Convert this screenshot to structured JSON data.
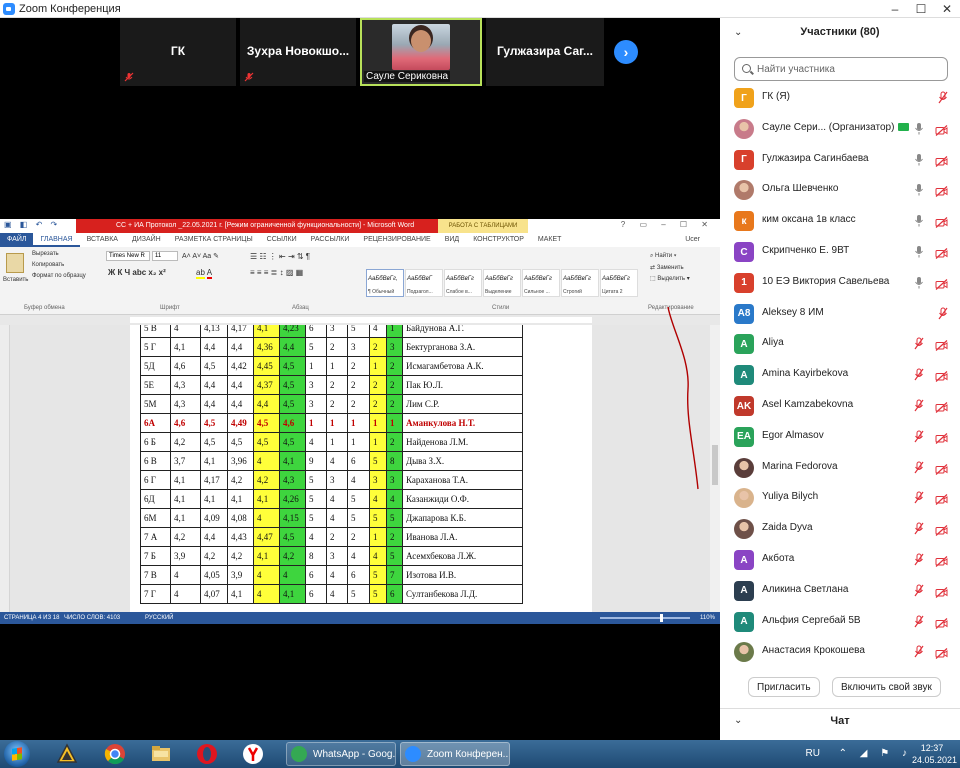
{
  "window": {
    "title": "Zoom Конференция",
    "controls": [
      "–",
      "☐",
      "✕"
    ]
  },
  "thumbnails": [
    {
      "name": "ГК",
      "mic_off": true
    },
    {
      "name": "Зухра Новокшо...",
      "mic_off": true
    },
    {
      "name": "Сауле Сериковна",
      "video": true,
      "active": true
    },
    {
      "name": "Гулжазира Саг..."
    }
  ],
  "word": {
    "title": "СС + ИА Протокол _22.05.2021 г. [Режим ограниченной функциональности] - Microsoft Word",
    "table_tools": "РАБОТА С ТАБЛИЦАМИ",
    "tabs": [
      "ФАЙЛ",
      "ГЛАВНАЯ",
      "ВСТАВКА",
      "ДИЗАЙН",
      "РАЗМЕТКА СТРАНИЦЫ",
      "ССЫЛКИ",
      "РАССЫЛКИ",
      "РЕЦЕНЗИРОВАНИЕ",
      "ВИД",
      "КОНСТРУКТОР",
      "МАКЕТ"
    ],
    "user": "Ucer",
    "ribbon": {
      "paste": "Вставить",
      "cut": "Вырезать",
      "copy": "Копировать",
      "format_painter": "Формат по образцу",
      "font_name": "Times New R",
      "font_size": "11",
      "group_clipboard": "Буфер обмена",
      "group_font": "Шрифт",
      "group_paragraph": "Абзац",
      "group_styles": "Стили",
      "group_editing": "Редактирование",
      "find": "Найти",
      "replace": "Заменить",
      "select": "Выделить",
      "styles": [
        {
          "sample": "АаБбВвГг,",
          "name": "¶ Обычный"
        },
        {
          "sample": "АаБбВвГ",
          "name": "Подзагол..."
        },
        {
          "sample": "АаБбВвГг",
          "name": "Слабое в..."
        },
        {
          "sample": "АаБбВвГг",
          "name": "Выделение"
        },
        {
          "sample": "АаБбВвГг",
          "name": "Сильное ..."
        },
        {
          "sample": "АаБбВвГг",
          "name": "Строгий"
        },
        {
          "sample": "АаБбВвГг",
          "name": "Цитата 2"
        }
      ]
    },
    "table_rows": [
      {
        "cells": [
          "5 В",
          "4",
          "4,13",
          "4,17",
          "4,1",
          "4,23",
          "6",
          "3",
          "5",
          "4",
          "1",
          "Байдунова А.Г."
        ],
        "hl": [
          "",
          "",
          "",
          "",
          "y",
          "g",
          "",
          "",
          "",
          "",
          "g",
          ""
        ]
      },
      {
        "cells": [
          "5 Г",
          "4,1",
          "4,4",
          "4,4",
          "4,36",
          "4,4",
          "5",
          "2",
          "3",
          "2",
          "3",
          "Бектурганова З.А."
        ],
        "hl": [
          "",
          "",
          "",
          "",
          "y",
          "g",
          "",
          "",
          "",
          "y",
          "g",
          ""
        ]
      },
      {
        "cells": [
          "5Д",
          "4,6",
          "4,5",
          "4,42",
          "4,45",
          "4,5",
          "1",
          "1",
          "2",
          "1",
          "2",
          "Исмагамбетова А.К."
        ],
        "hl": [
          "",
          "",
          "",
          "",
          "y",
          "g",
          "",
          "",
          "",
          "y",
          "g",
          ""
        ]
      },
      {
        "cells": [
          "5Е",
          "4,3",
          "4,4",
          "4,4",
          "4,37",
          "4,5",
          "3",
          "2",
          "2",
          "2",
          "2",
          "Пак Ю.Л."
        ],
        "hl": [
          "",
          "",
          "",
          "",
          "y",
          "g",
          "",
          "",
          "",
          "y",
          "g",
          ""
        ]
      },
      {
        "cells": [
          "5М",
          "4,3",
          "4,4",
          "4,4",
          "4,4",
          "4,5",
          "3",
          "2",
          "2",
          "2",
          "2",
          "Лим С.Р."
        ],
        "hl": [
          "",
          "",
          "",
          "",
          "y",
          "g",
          "",
          "",
          "",
          "y",
          "g",
          ""
        ]
      },
      {
        "cells": [
          "6А",
          "4,6",
          "4,5",
          "4,49",
          "4,5",
          "4,6",
          "1",
          "1",
          "1",
          "1",
          "1",
          "Аманкулова Н.Т."
        ],
        "hl": [
          "",
          "",
          "",
          "",
          "y",
          "g",
          "",
          "",
          "",
          "y",
          "g",
          ""
        ],
        "bold": true
      },
      {
        "cells": [
          "6 Б",
          "4,2",
          "4,5",
          "4,5",
          "4,5",
          "4,5",
          "4",
          "1",
          "1",
          "1",
          "2",
          "Найденова Л.М."
        ],
        "hl": [
          "",
          "",
          "",
          "",
          "y",
          "g",
          "",
          "",
          "",
          "y",
          "g",
          ""
        ]
      },
      {
        "cells": [
          "6 В",
          "3,7",
          "4,1",
          "3,96",
          "4",
          "4,1",
          "9",
          "4",
          "6",
          "5",
          "8",
          "Дыва З.Х."
        ],
        "hl": [
          "",
          "",
          "",
          "",
          "y",
          "g",
          "",
          "",
          "",
          "y",
          "g",
          ""
        ]
      },
      {
        "cells": [
          "6 Г",
          "4,1",
          "4,17",
          "4,2",
          "4,2",
          "4,3",
          "5",
          "3",
          "4",
          "3",
          "3",
          "Караханова Т.А."
        ],
        "hl": [
          "",
          "",
          "",
          "",
          "y",
          "g",
          "",
          "",
          "",
          "y",
          "g",
          ""
        ]
      },
      {
        "cells": [
          "6Д",
          "4,1",
          "4,1",
          "4,1",
          "4,1",
          "4,26",
          "5",
          "4",
          "5",
          "4",
          "4",
          "Казанжиди О.Ф."
        ],
        "hl": [
          "",
          "",
          "",
          "",
          "y",
          "g",
          "",
          "",
          "",
          "y",
          "g",
          ""
        ]
      },
      {
        "cells": [
          "6М",
          "4,1",
          "4,09",
          "4,08",
          "4",
          "4,15",
          "5",
          "4",
          "5",
          "5",
          "5",
          "Джапарова К.Б."
        ],
        "hl": [
          "",
          "",
          "",
          "",
          "y",
          "g",
          "",
          "",
          "",
          "y",
          "g",
          ""
        ]
      },
      {
        "cells": [
          "7 А",
          "4,2",
          "4,4",
          "4,43",
          "4,47",
          "4,5",
          "4",
          "2",
          "2",
          "1",
          "2",
          "Иванова Л.А."
        ],
        "hl": [
          "",
          "",
          "",
          "",
          "y",
          "g",
          "",
          "",
          "",
          "y",
          "g",
          ""
        ]
      },
      {
        "cells": [
          "7 Б",
          "3,9",
          "4,2",
          "4,2",
          "4,1",
          "4,2",
          "8",
          "3",
          "4",
          "4",
          "5",
          "Асемхбекова Л.Ж."
        ],
        "hl": [
          "",
          "",
          "",
          "",
          "y",
          "g",
          "",
          "",
          "",
          "y",
          "g",
          ""
        ]
      },
      {
        "cells": [
          "7 В",
          "4",
          "4,05",
          "3,9",
          "4",
          "4",
          "6",
          "4",
          "6",
          "5",
          "7",
          "Изотова И.В."
        ],
        "hl": [
          "",
          "",
          "",
          "",
          "y",
          "g",
          "",
          "",
          "",
          "y",
          "g",
          ""
        ]
      },
      {
        "cells": [
          "7 Г",
          "4",
          "4,07",
          "4,1",
          "4",
          "4,1",
          "6",
          "4",
          "5",
          "5",
          "6",
          "Султанбекова Л.Д."
        ],
        "hl": [
          "",
          "",
          "",
          "",
          "y",
          "g",
          "",
          "",
          "",
          "y",
          "g",
          ""
        ]
      }
    ],
    "status": {
      "page": "СТРАНИЦА 4 ИЗ 18",
      "words": "ЧИСЛО СЛОВ: 4103",
      "lang": "РУССКИЙ",
      "zoom": "110%"
    }
  },
  "participants": {
    "title": "Участники (80)",
    "search_placeholder": "Найти участника",
    "list": [
      {
        "initial": "Г",
        "color": "#f0a21b",
        "name": "ГК (Я)",
        "mic": false,
        "cam": false,
        "hide_mic_icon": true
      },
      {
        "initial": "",
        "color": "#c87b8a",
        "photo": true,
        "name": "Сауле Сери... (Организатор)",
        "mic": true,
        "cam": false,
        "sharing": true
      },
      {
        "initial": "Г",
        "color": "#d8402c",
        "name": "Гулжазира Сагинбаева",
        "mic": true,
        "cam": false
      },
      {
        "initial": "",
        "color": "#b07a6a",
        "photo": true,
        "name": "Ольга Шевченко",
        "mic": true,
        "cam": false
      },
      {
        "initial": "к",
        "color": "#e8781c",
        "name": "ким оксана 1в класс",
        "mic": true,
        "cam": false
      },
      {
        "initial": "С",
        "color": "#8a44c4",
        "name": "Скрипченко Е. 9ВТ",
        "mic": true,
        "cam": false
      },
      {
        "initial": "1",
        "color": "#d8402c",
        "name": "10 ЕЭ Виктория Савельева",
        "mic": true,
        "cam": false
      },
      {
        "initial": "A8",
        "color": "#2a79c9",
        "name": "Aleksey 8 ИМ",
        "mic": false,
        "cam": false,
        "hide_cam_icon": true
      },
      {
        "initial": "A",
        "color": "#2aa35a",
        "name": "Aliya",
        "mic": false,
        "cam": false
      },
      {
        "initial": "A",
        "color": "#1f8a7a",
        "name": "Amina Kayirbekova",
        "mic": false,
        "cam": false
      },
      {
        "initial": "AK",
        "color": "#c0392b",
        "name": "Asel Kamzabekovna",
        "mic": false,
        "cam": false
      },
      {
        "initial": "EA",
        "color": "#2aa35a",
        "name": "Egor Almasov",
        "mic": false,
        "cam": false
      },
      {
        "initial": "",
        "color": "#5a3d3a",
        "photo": true,
        "name": "Marina Fedorova",
        "mic": false,
        "cam": false
      },
      {
        "initial": "",
        "color": "#d9b38c",
        "photo": true,
        "name": "Yuliya Bilych",
        "mic": false,
        "cam": false
      },
      {
        "initial": "",
        "color": "#6e5048",
        "photo": true,
        "name": "Zaida Dyva",
        "mic": false,
        "cam": false
      },
      {
        "initial": "A",
        "color": "#8a44c4",
        "name": "Акбота",
        "mic": false,
        "cam": false
      },
      {
        "initial": "A",
        "color": "#2c3e50",
        "name": "Аликина Светлана",
        "mic": false,
        "cam": false
      },
      {
        "initial": "A",
        "color": "#1f8a7a",
        "name": "Альфия Сергебай 5В",
        "mic": false,
        "cam": false
      },
      {
        "initial": "",
        "color": "#6b7a4a",
        "photo": true,
        "name": "Анастасия Крокошева",
        "mic": false,
        "cam": false
      }
    ],
    "invite": "Пригласить",
    "unmute_me": "Включить свой звук",
    "chat": "Чат"
  },
  "taskbar": {
    "tasks": [
      {
        "label": "WhatsApp - Goog...",
        "color": "#34a853"
      },
      {
        "label": "Zoom Конферен...",
        "color": "#2d8cff",
        "active": true
      }
    ],
    "lang": "RU",
    "time": "12:37",
    "date": "24.05.2021"
  }
}
